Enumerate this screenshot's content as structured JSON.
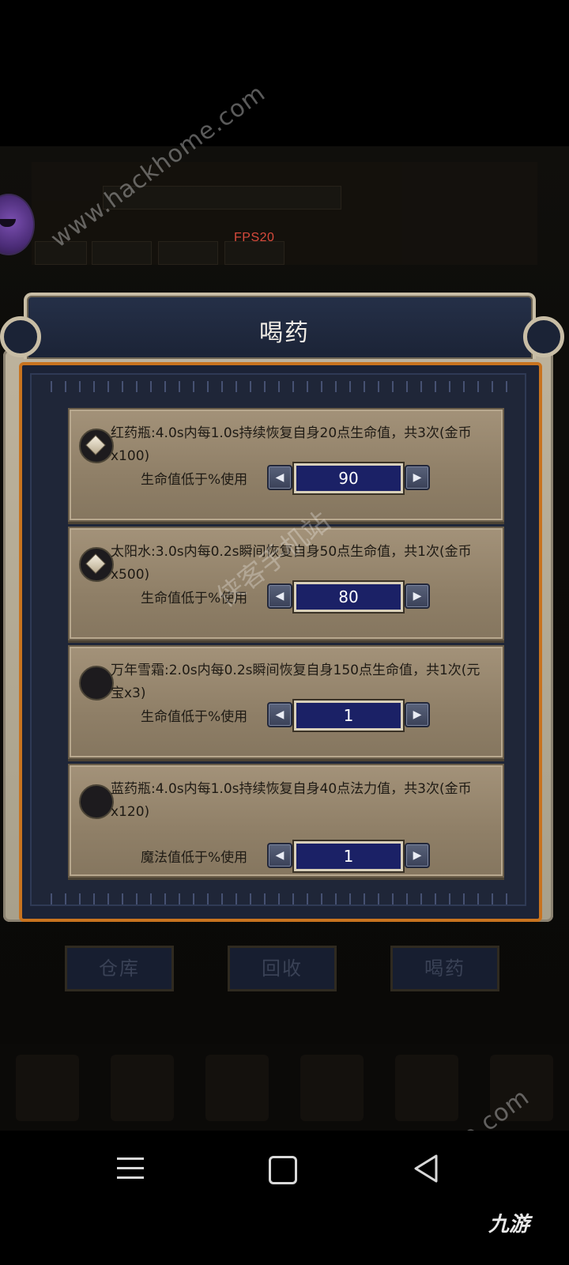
{
  "status": {
    "fps": "FPS20"
  },
  "dialog": {
    "title": "喝药",
    "potions": [
      {
        "description": "红药瓶:4.0s内每1.0s持续恢复自身20点生命值，共3次(金币x100)",
        "threshold_label": "生命值低于%使用",
        "value": "90",
        "icon": "diamond-icon",
        "enabled": true
      },
      {
        "description": "太阳水:3.0s内每0.2s瞬间恢复自身50点生命值，共1次(金币x500)",
        "threshold_label": "生命值低于%使用",
        "value": "80",
        "icon": "diamond-icon",
        "enabled": true
      },
      {
        "description": "万年雪霜:2.0s内每0.2s瞬间恢复自身150点生命值，共1次(元宝x3)",
        "threshold_label": "生命值低于%使用",
        "value": "1",
        "icon": "empty-circle-icon",
        "enabled": false
      },
      {
        "description": "蓝药瓶:4.0s内每1.0s持续恢复自身40点法力值，共3次(金币x120)",
        "threshold_label": "魔法值低于%使用",
        "value": "1",
        "icon": "empty-circle-icon",
        "enabled": false
      }
    ]
  },
  "bottom_buttons": {
    "warehouse": "仓库",
    "recycle": "回收",
    "drink": "喝药"
  },
  "watermark": {
    "site": "www.hackhome.com",
    "cn": "侠客手机站",
    "logo": "九游"
  },
  "colors": {
    "value_box": "#1b2166",
    "frame_orange": "#c8731f",
    "fps_text": "#d84a3c"
  }
}
